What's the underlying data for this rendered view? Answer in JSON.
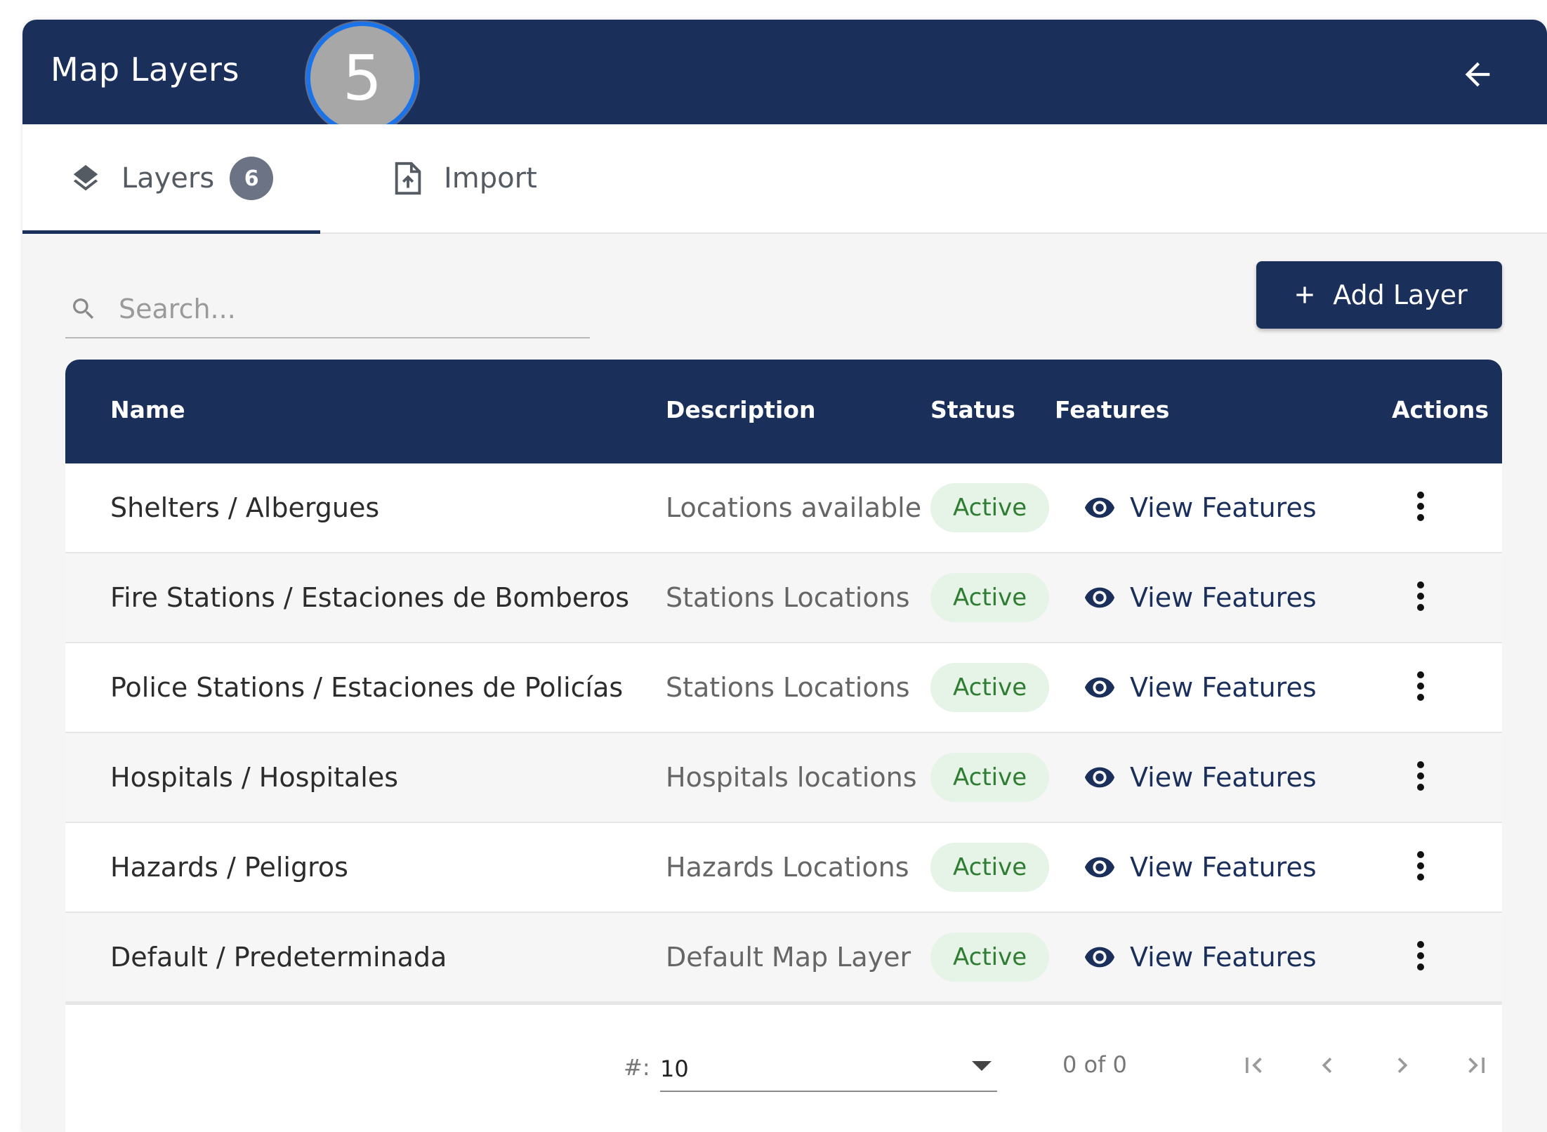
{
  "header": {
    "title": "Map Layers",
    "step_badge": "5",
    "back_icon": "arrow-left-icon"
  },
  "tabs": [
    {
      "label": "Layers",
      "icon": "layers-icon",
      "count": "6",
      "active": true
    },
    {
      "label": "Import",
      "icon": "file-upload-icon",
      "active": false
    }
  ],
  "search": {
    "placeholder": "Search...",
    "value": ""
  },
  "add_button": {
    "label": "Add Layer",
    "icon": "plus-icon"
  },
  "table": {
    "columns": [
      "Name",
      "Description",
      "Status",
      "Features",
      "Actions"
    ],
    "rows": [
      {
        "name": "Shelters / Albergues",
        "description": "Locations available",
        "status": "Active",
        "features": "View Features"
      },
      {
        "name": "Fire Stations / Estaciones de Bomberos",
        "description": "Stations Locations",
        "status": "Active",
        "features": "View Features"
      },
      {
        "name": "Police Stations / Estaciones de Policías",
        "description": "Stations Locations",
        "status": "Active",
        "features": "View Features"
      },
      {
        "name": "Hospitals / Hospitales",
        "description": "Hospitals locations",
        "status": "Active",
        "features": "View Features"
      },
      {
        "name": "Hazards / Peligros",
        "description": "Hazards Locations",
        "status": "Active",
        "features": "View Features"
      },
      {
        "name": "Default / Predeterminada",
        "description": "Default Map Layer",
        "status": "Active",
        "features": "View Features"
      }
    ]
  },
  "pagination": {
    "per_page_label": "#:",
    "per_page_value": "10",
    "range": "0 of 0"
  },
  "colors": {
    "header_bg": "#1b2f5b",
    "status_bg": "#e6f3e7",
    "status_text": "#2e7d32",
    "step_ring": "#1a73e8"
  }
}
